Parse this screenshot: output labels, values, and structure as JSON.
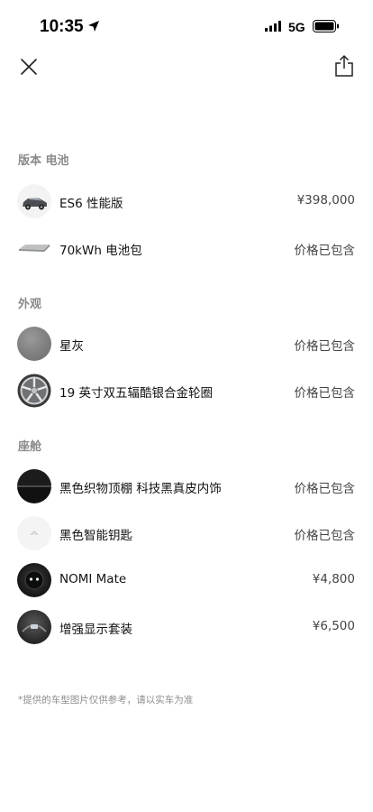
{
  "status": {
    "time": "10:35",
    "network": "5G"
  },
  "sections": [
    {
      "title": "版本 电池",
      "items": [
        {
          "label": "ES6 性能版",
          "price": "¥398,000",
          "thumb": "car-icon"
        },
        {
          "label": "70kWh 电池包",
          "price": "价格已包含",
          "thumb": "battery-pack-icon"
        }
      ]
    },
    {
      "title": "外观",
      "items": [
        {
          "label": "星灰",
          "price": "价格已包含",
          "thumb": "color-swatch-icon"
        },
        {
          "label": "19 英寸双五辐酷银合金轮圈",
          "price": "价格已包含",
          "thumb": "wheel-icon"
        }
      ]
    },
    {
      "title": "座舱",
      "items": [
        {
          "label": "黑色织物顶棚 科技黑真皮内饰",
          "price": "价格已包含",
          "thumb": "interior-swatch-icon"
        },
        {
          "label": "黑色智能钥匙",
          "price": "价格已包含",
          "thumb": "key-icon"
        },
        {
          "label": "NOMI Mate",
          "price": "¥4,800",
          "thumb": "nomi-icon"
        },
        {
          "label": "增强显示套装",
          "price": "¥6,500",
          "thumb": "display-package-icon"
        }
      ]
    }
  ],
  "disclaimer": "*提供的车型图片仅供参考，请以实车为准",
  "icons": [
    "close-icon",
    "share-icon",
    "location-arrow-icon",
    "signal-icon",
    "battery-icon"
  ]
}
